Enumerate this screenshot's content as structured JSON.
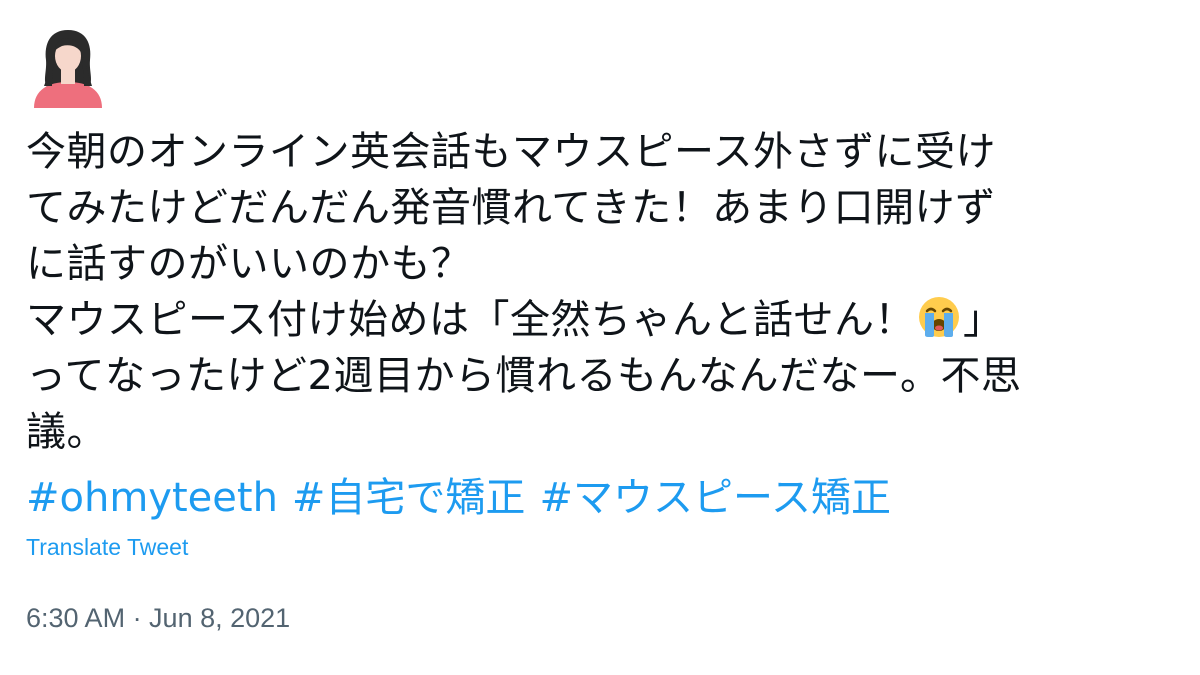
{
  "avatar": {
    "icon": "woman-avatar-icon",
    "background": "#ffffff",
    "shirt_color": "#ee6f7d",
    "hair_color": "#2b2b2b",
    "skin_color": "#f6d7cb"
  },
  "tweet": {
    "lines": [
      "今朝のオンライン英会話もマウスピース外さずに受け",
      "てみたけどだんだん発音慣れてきた！あまり口開けず",
      "に話すのがいいのかも？"
    ],
    "line4_before_emoji": "マウスピース付け始めは「全然ちゃんと話せん！",
    "line4_emoji": "loudly-crying-face-icon",
    "line4_after_emoji": "」",
    "lines_end": [
      "ってなったけど2週目から慣れるもんなんだなー。不思",
      "議。"
    ]
  },
  "hashtags": [
    "#ohmyteeth",
    "#自宅で矯正",
    "#マウスピース矯正"
  ],
  "translate_label": "Translate Tweet",
  "timestamp": "6:30 AM · Jun 8, 2021",
  "colors": {
    "text": "#0f1419",
    "link": "#1d9bf0",
    "meta": "#536471"
  }
}
